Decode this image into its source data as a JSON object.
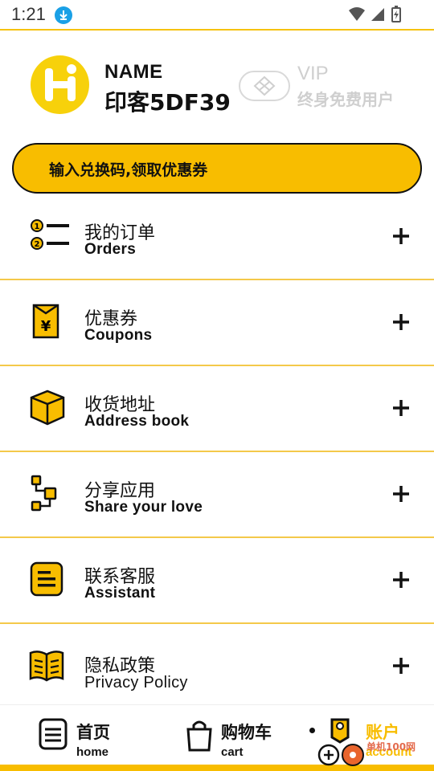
{
  "status": {
    "time": "1:21"
  },
  "profile": {
    "name_label": "NAME",
    "name_value": "印客5DF39",
    "vip_label": "VIP",
    "vip_sub": "终身免费用户"
  },
  "redeem": {
    "label": "输入兑换码,领取优惠券"
  },
  "menu": [
    {
      "zh": "我的订单",
      "en": "Orders",
      "icon": "orders-icon"
    },
    {
      "zh": "优惠券",
      "en": "Coupons",
      "icon": "coupon-icon"
    },
    {
      "zh": "收货地址",
      "en": "Address book",
      "icon": "box-icon"
    },
    {
      "zh": "分享应用",
      "en": "Share your love",
      "icon": "share-icon"
    },
    {
      "zh": "联系客服",
      "en": "Assistant",
      "icon": "chat-icon"
    },
    {
      "zh": "隐私政策",
      "en": "Privacy Policy",
      "icon": "book-icon"
    }
  ],
  "nav": [
    {
      "zh": "首页",
      "en": "home",
      "icon": "home-icon",
      "active": false
    },
    {
      "zh": "购物车",
      "en": "cart",
      "icon": "bag-icon",
      "active": false
    },
    {
      "zh": "账户",
      "en": "account",
      "icon": "account-icon",
      "active": true
    }
  ],
  "watermark": "单机100网",
  "colors": {
    "accent": "#f8bd00",
    "divider": "#f4c94a",
    "muted": "#cfcfcf",
    "active_nav": "#f8bd00"
  }
}
